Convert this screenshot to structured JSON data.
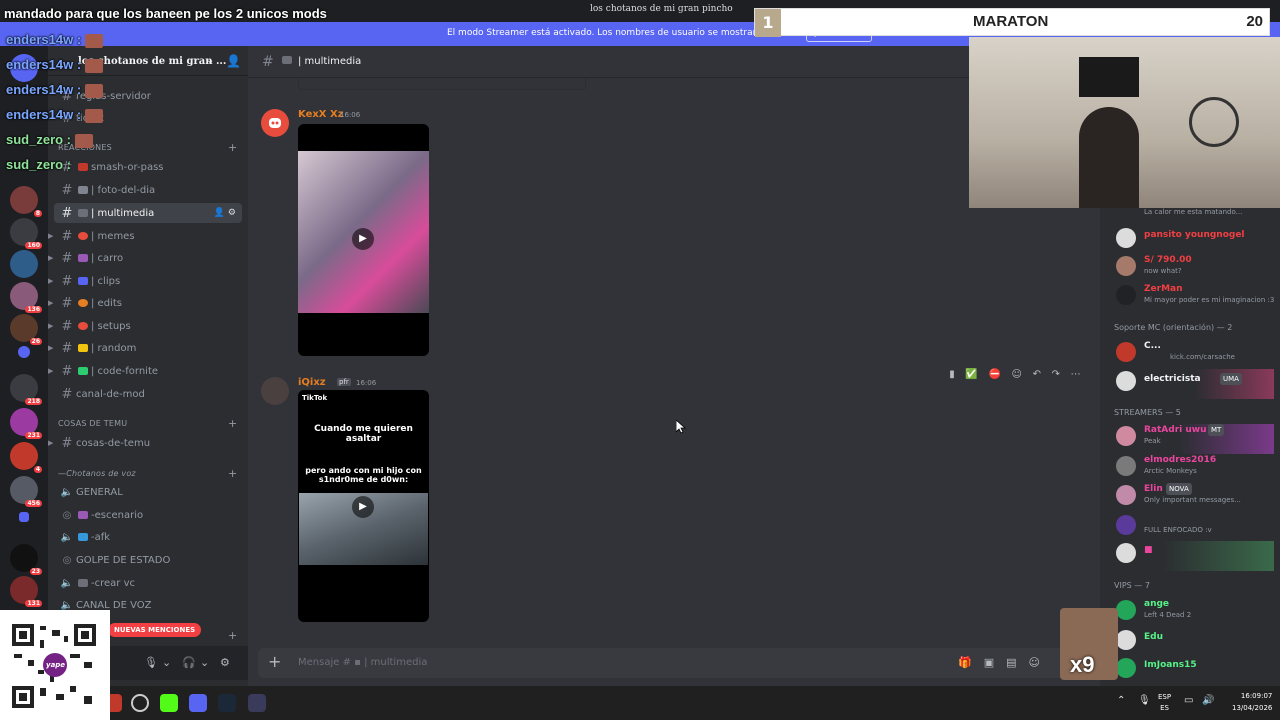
{
  "window": {
    "title": "los chotanos de mi gran pincho"
  },
  "streamer_banner": {
    "text": "El modo Streamer está activado. Los nombres de usuario se mostrarán de forma parcial",
    "button": "Desactivar"
  },
  "server": {
    "name": "los chotanos de mi gran ..."
  },
  "channels": {
    "top": [
      {
        "label": "reglas-servidor"
      },
      {
        "label": "ticket"
      }
    ],
    "cat_reacciones": "REACCIONES",
    "reacciones": [
      {
        "label": "smash-or-pass"
      },
      {
        "label": "| foto-del-dia"
      },
      {
        "label": "| multimedia"
      },
      {
        "label": "| memes"
      },
      {
        "label": "| carro"
      },
      {
        "label": "| clips"
      },
      {
        "label": "| edits"
      },
      {
        "label": "| setups"
      },
      {
        "label": "| random"
      },
      {
        "label": "| code-fornite"
      },
      {
        "label": "canal-de-mod"
      }
    ],
    "cat_temu": "COSAS DE TEMU",
    "temu": [
      {
        "label": "cosas-de-temu"
      }
    ],
    "cat_voz": "—Chotanos de voz",
    "voice": [
      {
        "label": "GENERAL"
      },
      {
        "label": "-escenario"
      },
      {
        "label": "-afk"
      },
      {
        "label": "GOLPE DE ESTADO"
      },
      {
        "label": "-crear vc"
      },
      {
        "label": "CANAL DE VOZ"
      }
    ],
    "mentions": "NUEVAS MENCIONES"
  },
  "rail_badges": [
    "8",
    "160",
    "136",
    "26",
    "218",
    "231",
    "4",
    "456",
    "23",
    "131"
  ],
  "chat": {
    "channel": "| multimedia",
    "messages": [
      {
        "author": "KexX Xz",
        "time": "16:06",
        "color": "#e67e22"
      },
      {
        "author": "iQixz",
        "tag": "pfr",
        "time": "16:06",
        "color": "#e67e22",
        "tiktok_brand": "TikTok",
        "tiktok_line1": "Cuando me quieren asaltar",
        "tiktok_line2": "pero ando con mi hijo con s1ndr0me de d0wn:"
      }
    ],
    "composer_placeholder": "Mensaje #",
    "composer_channel": "| multimedia"
  },
  "members": {
    "top": [
      {
        "name": "",
        "status": "La calor me esta matando...",
        "color": "#949ba4"
      },
      {
        "name": "pansito youngnogel",
        "status": "",
        "color": "#f23f43"
      },
      {
        "name": "S/ 790.00",
        "status": "now what?",
        "color": "#f23f43"
      },
      {
        "name": "ZerMan",
        "status": "Mi mayor poder es mi imaginacion :3",
        "color": "#f23f43"
      }
    ],
    "group_mc": "Soporte MC (orientación) — 2",
    "mc": [
      {
        "name": "C...",
        "status": "kick.com/carsache",
        "color": "#f2f3f5"
      },
      {
        "name": "electricista",
        "tag": "UMA",
        "status": "",
        "color": "#f2f3f5"
      }
    ],
    "group_streamers": "STREAMERS — 5",
    "streamers": [
      {
        "name": "RatAdri uwu",
        "tag": "MT",
        "status": "Peak",
        "color": "#eb459e"
      },
      {
        "name": "elmodres2016",
        "status": "Arctic Monkeys",
        "color": "#eb459e"
      },
      {
        "name": "Elin",
        "tag": "NOVA",
        "status": "Only important messages...",
        "color": "#eb459e"
      },
      {
        "name": "",
        "status": "FULL ENFOCADO :v",
        "color": "#eb459e"
      },
      {
        "name": "",
        "status": "",
        "color": "#eb459e"
      }
    ],
    "group_vips": "VIPS — 7",
    "vips": [
      {
        "name": "ange",
        "status": "Left 4 Dead 2",
        "color": "#57f287"
      },
      {
        "name": "Edu",
        "status": "",
        "color": "#57f287"
      },
      {
        "name": "ImJoans15",
        "status": "",
        "color": "#57f287"
      }
    ]
  },
  "overlay": {
    "title": "mandado para que los baneen pe los 2 unicos mods",
    "chat": [
      {
        "user": "enders14w :"
      },
      {
        "user": "enders14w :"
      },
      {
        "user": "enders14w :"
      },
      {
        "user": "enders14w :"
      },
      {
        "user": "sud_zero :"
      },
      {
        "user": "sud_zero :"
      }
    ],
    "maraton_left": "1",
    "maraton_title": "MARATON",
    "maraton_right": "20",
    "x9": "x9",
    "qr_text": "yape"
  },
  "taskbar": {
    "lang1": "ESP",
    "lang2": "ES",
    "time": "16:09:07",
    "date": "13/04/2026"
  },
  "colors": {
    "accent": "#5865f2",
    "danger": "#f23f43",
    "online": "#23a55a"
  }
}
